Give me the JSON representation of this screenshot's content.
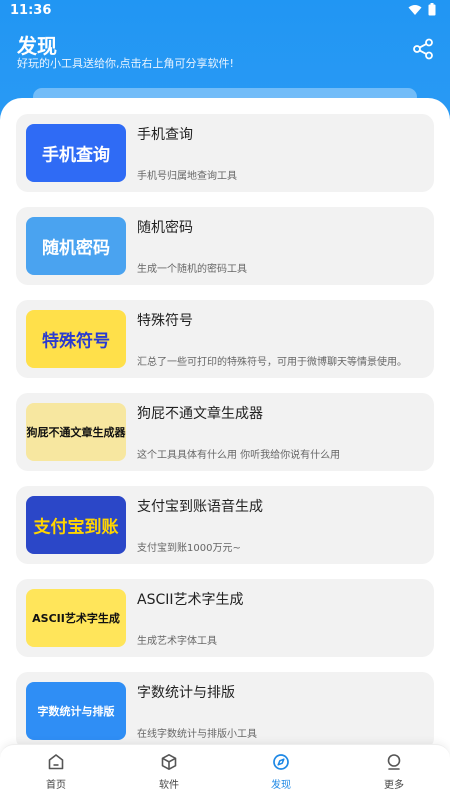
{
  "status": {
    "time": "11:36"
  },
  "header": {
    "title": "发现",
    "subtitle": "好玩的小工具送给你,点击右上角可分享软件!"
  },
  "tools": [
    {
      "title": "手机查询",
      "desc": "手机号归属地查询工具",
      "thumb_text": "手机查询",
      "thumb_bg": "#2f6bf5",
      "thumb_fg": "#ffffff"
    },
    {
      "title": "随机密码",
      "desc": "生成一个随机的密码工具",
      "thumb_text": "随机密码",
      "thumb_bg": "#4aa3f0",
      "thumb_fg": "#ffffff"
    },
    {
      "title": "特殊符号",
      "desc": "汇总了一些可打印的特殊符号，可用于微博聊天等情景使用。",
      "thumb_text": "特殊符号",
      "thumb_bg": "#ffe04a",
      "thumb_fg": "#2a3bd0"
    },
    {
      "title": "狗屁不通文章生成器",
      "desc": "这个工具具体有什么用 你听我给你说有什么用",
      "thumb_text": "狗屁不通文章生成器",
      "thumb_bg": "#f7e7a0",
      "thumb_fg": "#111111"
    },
    {
      "title": "支付宝到账语音生成",
      "desc": "支付宝到账1000万元~",
      "thumb_text": "支付宝到账",
      "thumb_bg": "#2b47c8",
      "thumb_fg": "#ffd400"
    },
    {
      "title": "ASCII艺术字生成",
      "desc": "生成艺术字体工具",
      "thumb_text": "ASCII艺术字生成",
      "thumb_bg": "#ffe55a",
      "thumb_fg": "#111111"
    },
    {
      "title": "字数统计与排版",
      "desc": "在线字数统计与排版小工具",
      "thumb_text": "字数统计与排版",
      "thumb_bg": "#2f8ef5",
      "thumb_fg": "#ffffff"
    }
  ],
  "tabs": [
    {
      "label": "首页",
      "icon": "home-icon",
      "active": false
    },
    {
      "label": "软件",
      "icon": "cube-icon",
      "active": false
    },
    {
      "label": "发现",
      "icon": "compass-icon",
      "active": true
    },
    {
      "label": "更多",
      "icon": "more-icon",
      "active": false
    }
  ],
  "colors": {
    "primary": "#2196f3",
    "active_tab": "#1e88e5",
    "card_bg": "#f2f2f2"
  }
}
